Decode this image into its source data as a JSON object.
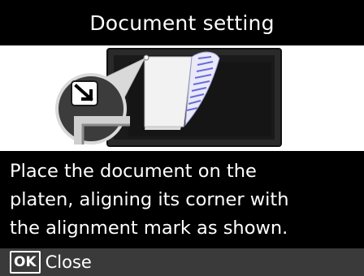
{
  "screen": {
    "title": "Document setting",
    "message": "Place the document on the\nplaten, aligning its corner with\nthe alignment mark as shown.",
    "footer": {
      "ok_key_label": "OK",
      "action_label": "Close"
    },
    "illustration": {
      "icon": "document-on-platen-illustration",
      "colors": {
        "platen": "#2a2a2a",
        "document": "#f2f2f2",
        "curl_lines": "#6a6adc",
        "magnifier": "#3c3c3c"
      }
    }
  }
}
